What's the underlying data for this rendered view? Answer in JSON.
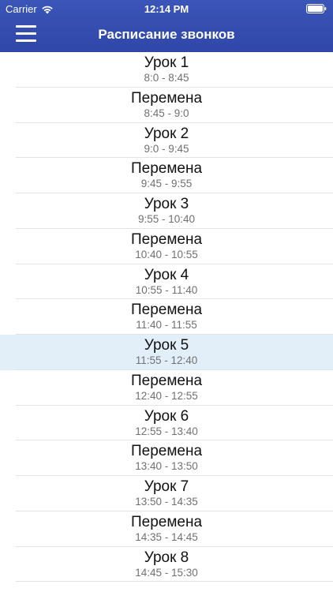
{
  "status_bar": {
    "carrier": "Carrier",
    "time": "12:14 PM",
    "wifi_icon": "wifi-icon",
    "battery_icon": "battery-icon"
  },
  "nav": {
    "title": "Расписание звонков",
    "menu_icon": "hamburger-menu-icon",
    "background_color": "#3a55b8"
  },
  "schedule": {
    "selected_index": 8,
    "selected_color": "#e3eff8",
    "items": [
      {
        "title": "Урок 1",
        "time": "8:0 - 8:45"
      },
      {
        "title": "Перемена",
        "time": "8:45 - 9:0"
      },
      {
        "title": "Урок 2",
        "time": "9:0 - 9:45"
      },
      {
        "title": "Перемена",
        "time": "9:45 - 9:55"
      },
      {
        "title": "Урок 3",
        "time": "9:55 - 10:40"
      },
      {
        "title": "Перемена",
        "time": "10:40 - 10:55"
      },
      {
        "title": "Урок 4",
        "time": "10:55 - 11:40"
      },
      {
        "title": "Перемена",
        "time": "11:40 - 11:55"
      },
      {
        "title": "Урок 5",
        "time": "11:55 - 12:40"
      },
      {
        "title": "Перемена",
        "time": "12:40 - 12:55"
      },
      {
        "title": "Урок 6",
        "time": "12:55 - 13:40"
      },
      {
        "title": "Перемена",
        "time": "13:40 - 13:50"
      },
      {
        "title": "Урок 7",
        "time": "13:50 - 14:35"
      },
      {
        "title": "Перемена",
        "time": "14:35 - 14:45"
      },
      {
        "title": "Урок 8",
        "time": "14:45 - 15:30"
      }
    ]
  }
}
